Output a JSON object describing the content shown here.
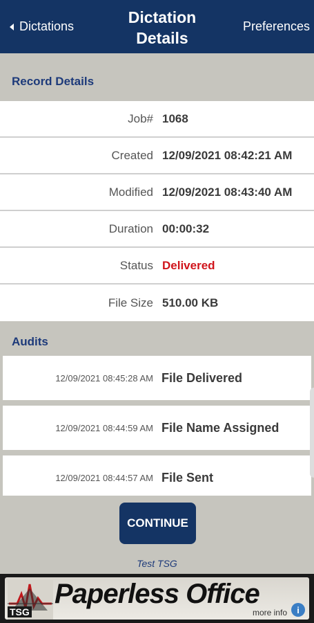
{
  "nav": {
    "back_label": "Dictations",
    "title_line1": "Dictation",
    "title_line2": "Details",
    "preferences_label": "Preferences"
  },
  "record_details": {
    "title": "Record Details",
    "rows": [
      {
        "label": "Job#",
        "value": "1068"
      },
      {
        "label": "Created",
        "value": "12/09/2021 08:42:21 AM"
      },
      {
        "label": "Modified",
        "value": "12/09/2021 08:43:40 AM"
      },
      {
        "label": "Duration",
        "value": "00:00:32"
      },
      {
        "label": "Status",
        "value": "Delivered"
      },
      {
        "label": "File Size",
        "value": "510.00 KB"
      }
    ]
  },
  "audits": {
    "title": "Audits",
    "items": [
      {
        "timestamp": "12/09/2021 08:45:28 AM",
        "event": "File Delivered"
      },
      {
        "timestamp": "12/09/2021 08:44:59 AM",
        "event": "File Name Assigned"
      },
      {
        "timestamp": "12/09/2021 08:44:57 AM",
        "event": "File Sent"
      }
    ]
  },
  "continue_label": "CONTINUE",
  "footer_text": "Test TSG",
  "banner": {
    "logo_text": "TSG",
    "title": "Paperless Office",
    "more_info": "more info",
    "info_icon": "i"
  },
  "colors": {
    "navbar": "#143464",
    "status_delivered": "#d0141b",
    "section_title": "#1d3a7a",
    "background": "#c6c5be"
  }
}
